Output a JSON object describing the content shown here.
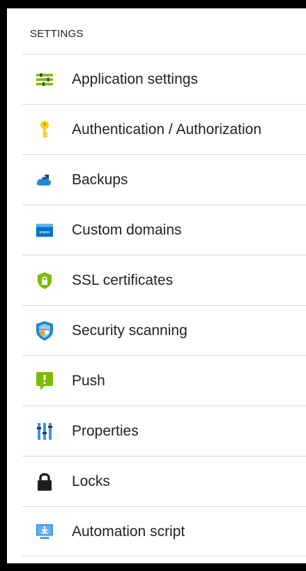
{
  "section": {
    "title": "SETTINGS"
  },
  "items": [
    {
      "label": "Application settings",
      "icon": "sliders-icon"
    },
    {
      "label": "Authentication / Authorization",
      "icon": "key-icon"
    },
    {
      "label": "Backups",
      "icon": "cloud-backup-icon"
    },
    {
      "label": "Custom domains",
      "icon": "www-window-icon"
    },
    {
      "label": "SSL certificates",
      "icon": "shield-lock-icon"
    },
    {
      "label": "Security scanning",
      "icon": "security-shield-icon"
    },
    {
      "label": "Push",
      "icon": "push-notification-icon"
    },
    {
      "label": "Properties",
      "icon": "properties-bars-icon"
    },
    {
      "label": "Locks",
      "icon": "padlock-icon"
    },
    {
      "label": "Automation script",
      "icon": "download-monitor-icon"
    }
  ],
  "colors": {
    "green": "#7fba00",
    "yellow": "#fcd116",
    "blue": "#0072c6",
    "dark": "#333333",
    "divider": "#d9d9d9"
  }
}
